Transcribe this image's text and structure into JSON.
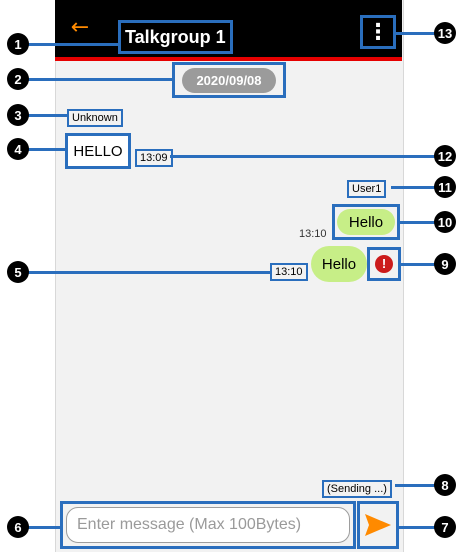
{
  "header": {
    "title": "Talkgroup 1",
    "back_icon": "arrow-left-icon",
    "menu_icon": "more-vertical-icon"
  },
  "chat": {
    "date": "2020/09/08",
    "incoming": {
      "sender": "Unknown",
      "text": "HELLO",
      "time": "13:09"
    },
    "outgoing": [
      {
        "sender": "User1",
        "text": "Hello",
        "time": "13:10"
      },
      {
        "text": "Hello",
        "time": "13:10",
        "status_icon": "error-icon"
      }
    ],
    "sending_status": "(Sending ...)"
  },
  "composer": {
    "placeholder": "Enter message (Max 100Bytes)",
    "send_icon": "send-icon"
  },
  "callouts": [
    "1",
    "2",
    "3",
    "4",
    "5",
    "6",
    "7",
    "8",
    "9",
    "10",
    "11",
    "12",
    "13"
  ],
  "colors": {
    "header": "#000000",
    "header_accent": "#e60000",
    "back_arrow": "#ff8a00",
    "outgoing_bubble": "#c7ee87",
    "send_arrow": "#ff8a00",
    "annotation": "#2a6ebd"
  }
}
